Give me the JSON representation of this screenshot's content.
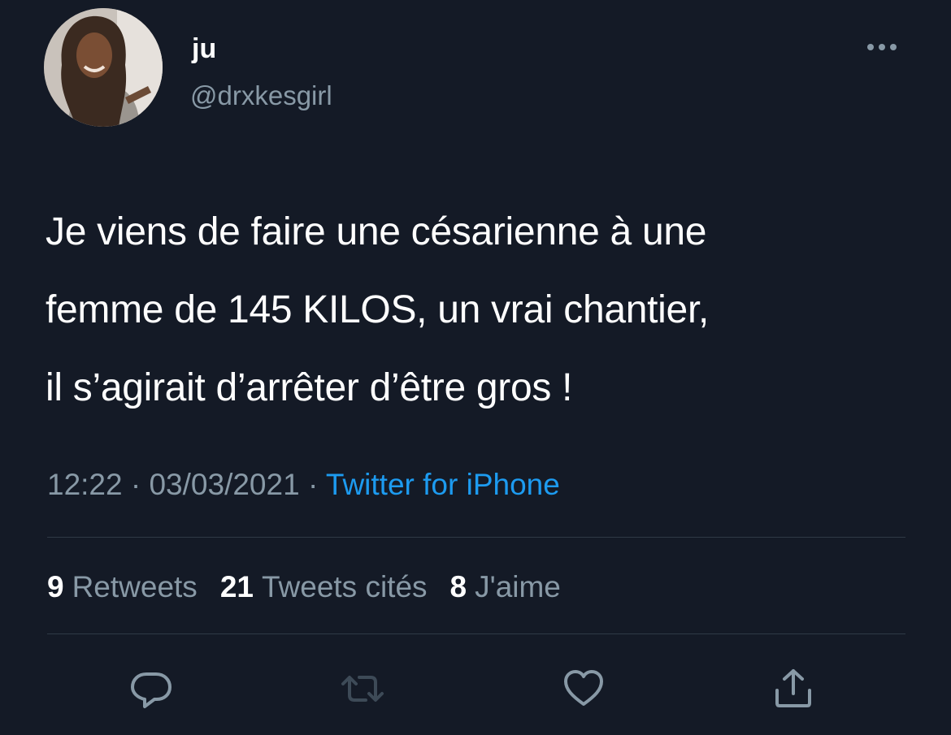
{
  "author": {
    "name": "ju",
    "handle": "@drxkesgirl"
  },
  "tweet": {
    "text": "Je viens de faire une césarienne à une\nfemme de 145 KILOS, un vrai chantier,\nil s’agirait d’arrêter d’être gros !",
    "time": "12:22",
    "separator": "·",
    "date": "03/03/2021",
    "source": "Twitter for iPhone"
  },
  "stats": {
    "retweets_count": "9",
    "retweets_label": "Retweets",
    "quotes_count": "21",
    "quotes_label": "Tweets cités",
    "likes_count": "8",
    "likes_label": "J'aime"
  },
  "icons": {
    "more": "more-horizontal-icon",
    "reply": "reply-icon",
    "retweet": "retweet-icon",
    "like": "heart-icon",
    "share": "share-icon"
  },
  "colors": {
    "background": "#141a26",
    "text": "#ffffff",
    "secondary": "#8899a6",
    "link": "#1d9bf0",
    "divider": "#2f3a46"
  }
}
